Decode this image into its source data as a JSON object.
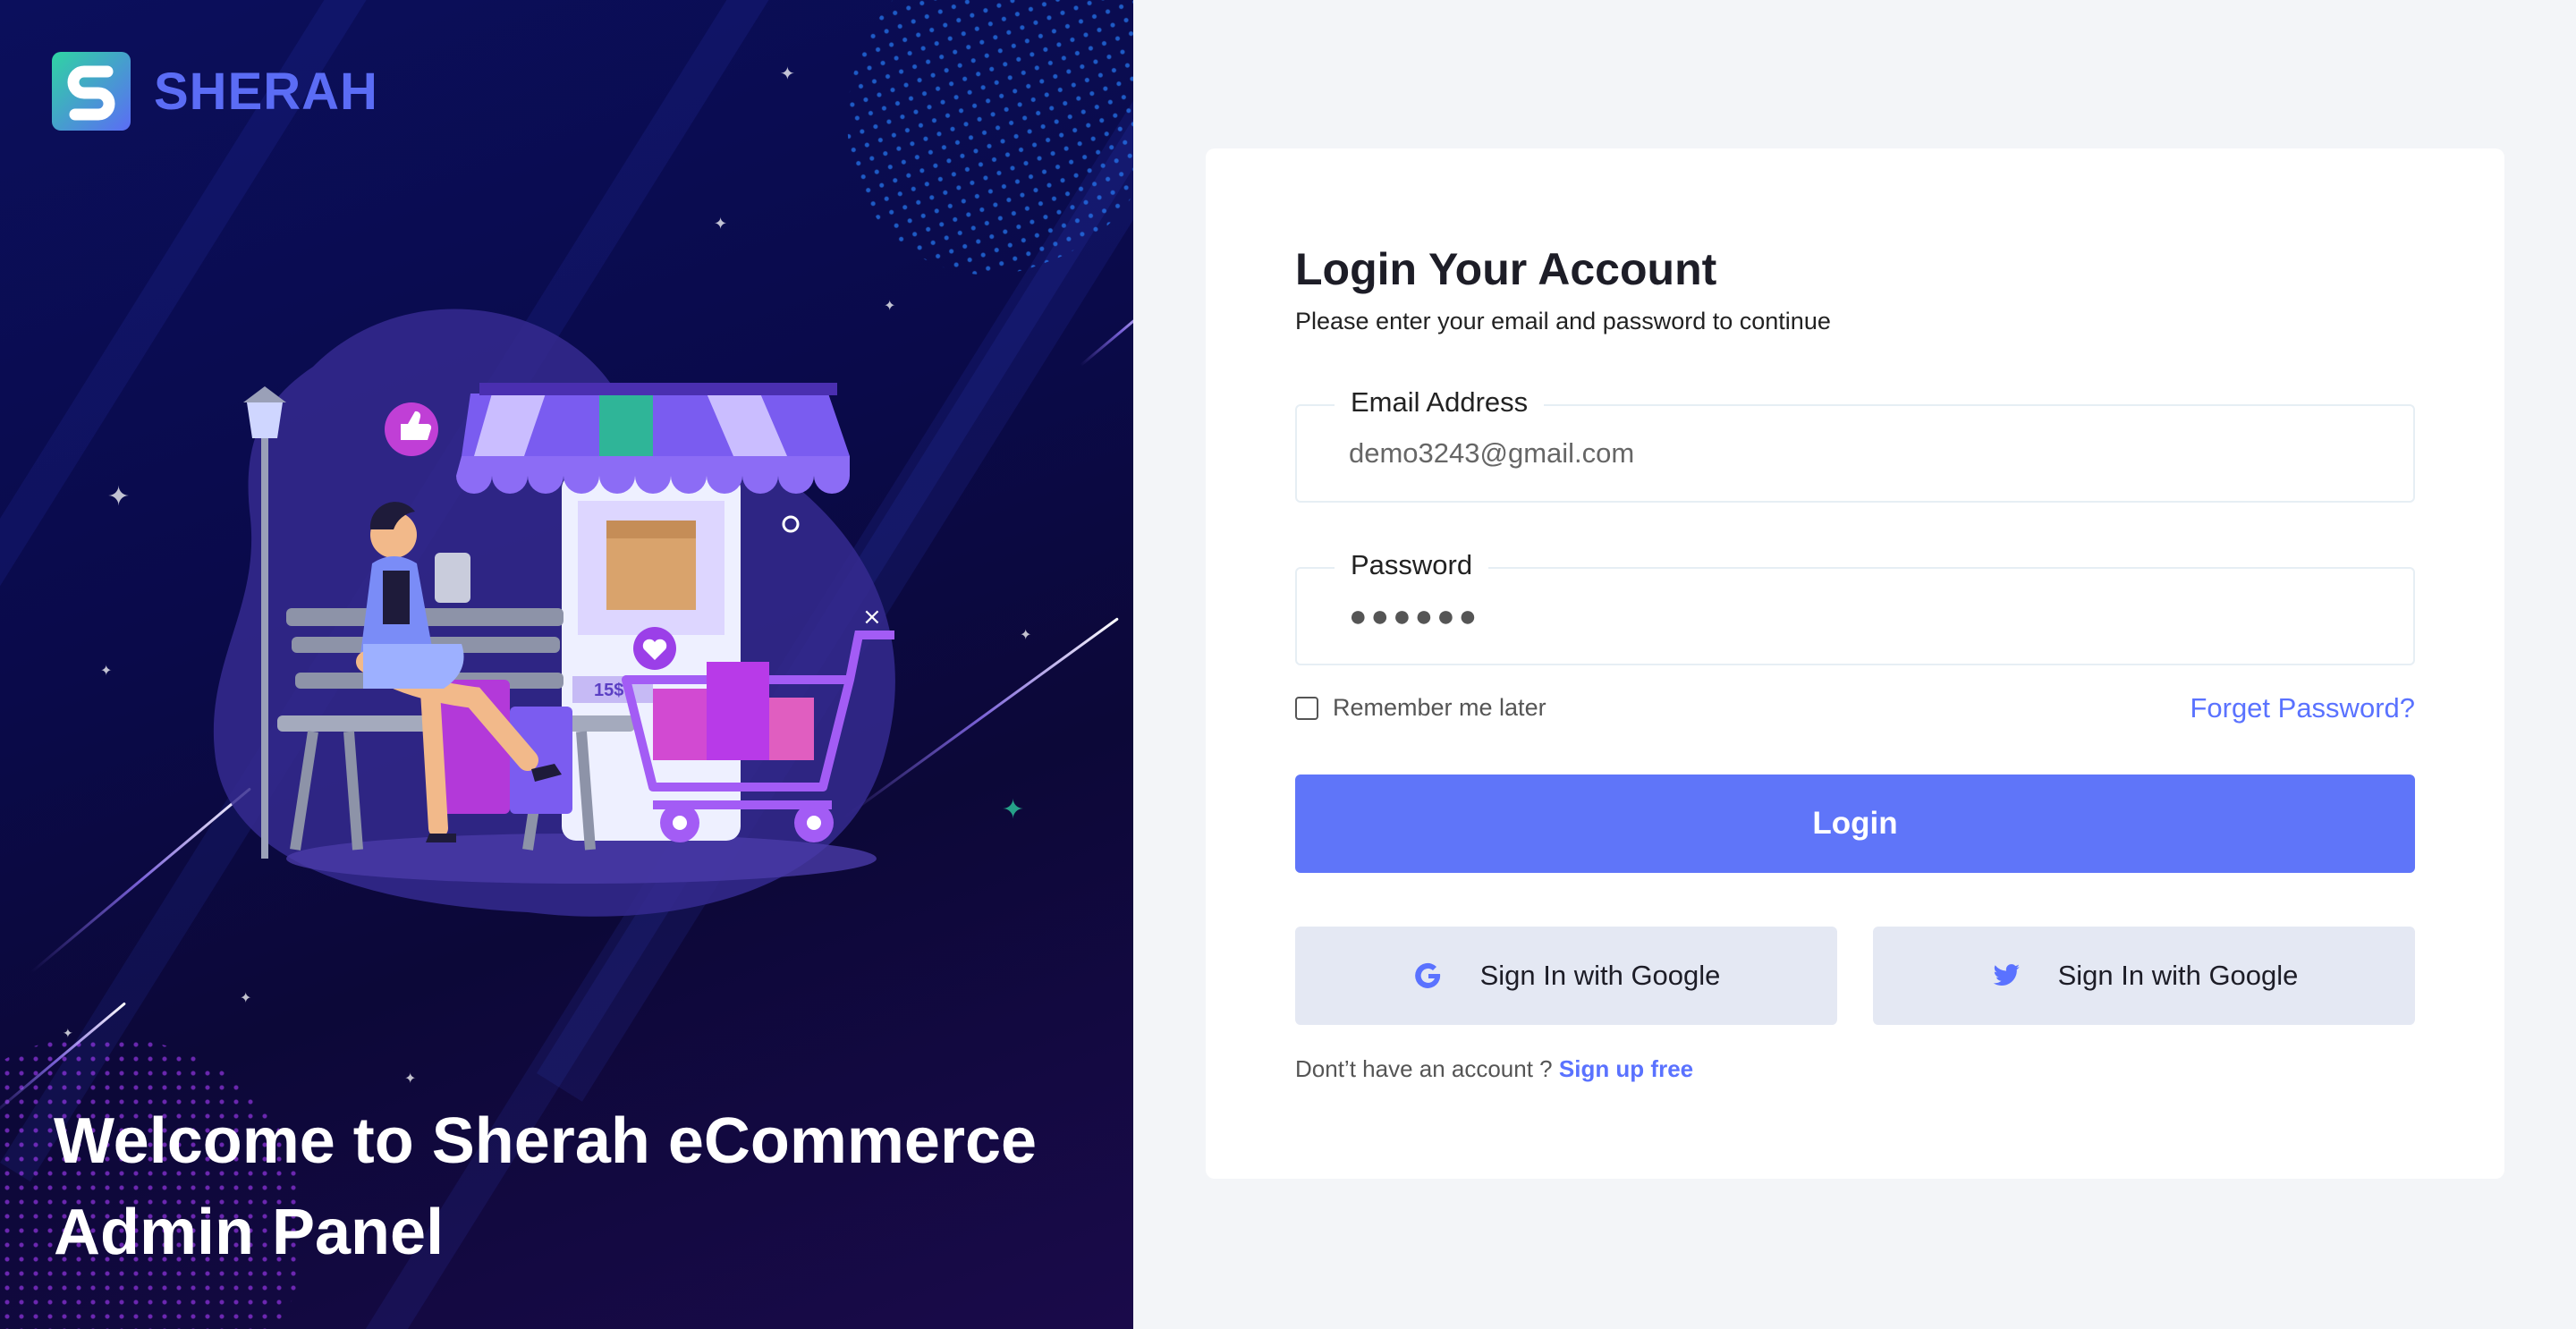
{
  "brand": {
    "name": "SHERAH"
  },
  "hero": {
    "welcome_line1": "Welcome to Sherah eCommerce",
    "welcome_line2": "Admin Panel",
    "illustration": {
      "price_tag": "15$"
    }
  },
  "login": {
    "title": "Login Your Account",
    "subtitle": "Please enter your email and password to continue",
    "email": {
      "label": "Email Address",
      "value": "demo3243@gmail.com"
    },
    "password": {
      "label": "Password",
      "value": "●●●●●●"
    },
    "remember_label": "Remember me later",
    "forgot_label": "Forget Password?",
    "login_label": "Login",
    "google_label": "Sign In with Google",
    "twitter_label": "Sign In with Google",
    "signup_prompt": "Dont’t have an account ?",
    "signup_link": "Sign up free"
  },
  "colors": {
    "accent": "#5f75f9",
    "link": "#5a72ff",
    "hero_bg": "#0b0f5c",
    "card_bg": "#ffffff",
    "page_bg": "#f3f5f8",
    "social_bg": "#e4e8f3"
  },
  "icons": [
    "google-icon",
    "twitter-icon",
    "logo-icon"
  ]
}
